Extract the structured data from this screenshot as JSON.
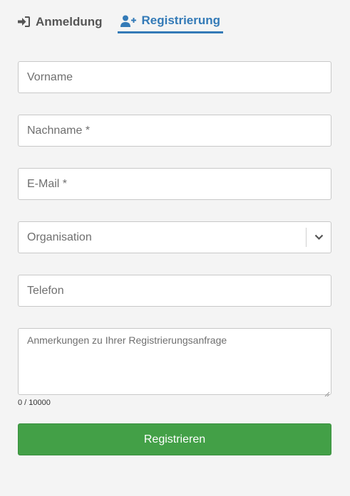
{
  "tabs": {
    "login": {
      "label": "Anmeldung",
      "icon": "sign-in-icon"
    },
    "register": {
      "label": "Registrierung",
      "icon": "user-plus-icon",
      "active": true
    }
  },
  "form": {
    "first_name": {
      "value": "",
      "placeholder": "Vorname"
    },
    "last_name": {
      "value": "",
      "placeholder": "Nachname *"
    },
    "email": {
      "value": "",
      "placeholder": "E-Mail *"
    },
    "organisation": {
      "selected": "Organisation",
      "icon": "chevron-down-icon"
    },
    "phone": {
      "value": "",
      "placeholder": "Telefon"
    },
    "notes": {
      "value": "",
      "placeholder": "Anmerkungen zu Ihrer Registrierungsanfrage",
      "counter": "0 / 10000"
    },
    "submit_label": "Registrieren"
  },
  "colors": {
    "accent": "#337ab7",
    "submit": "#43a047",
    "background": "#f4f4f4"
  }
}
